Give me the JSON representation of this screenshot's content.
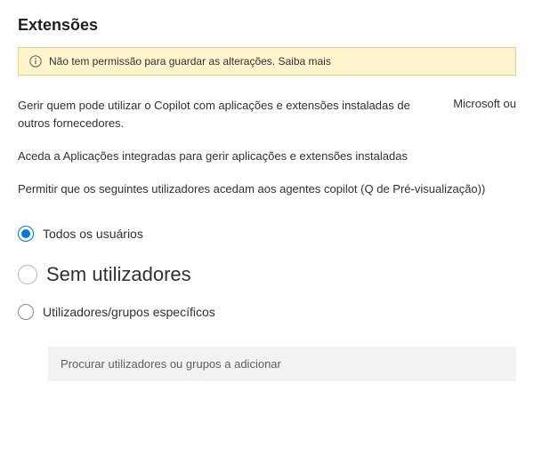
{
  "page": {
    "title": "Extensões"
  },
  "banner": {
    "message": "Não tem permissão para guardar as alterações.",
    "learn_more": "Saiba mais"
  },
  "description": {
    "main": "Gerir quem pode utilizar o Copilot com aplicações e extensões instaladas de outros fornecedores.",
    "right_text": "Microsoft ou",
    "sub": "Aceda a Aplicações integradas para gerir aplicações e extensões instaladas"
  },
  "section": {
    "label": "Permitir que os seguintes utilizadores acedam aos agentes copilot (Q de Pré-visualização))"
  },
  "radios": {
    "all_users": "Todos os usuários",
    "no_users": "Sem utilizadores",
    "specific": "Utilizadores/grupos específicos"
  },
  "search": {
    "placeholder": "Procurar utilizadores ou grupos a adicionar"
  },
  "icons": {
    "info": "info-icon"
  }
}
